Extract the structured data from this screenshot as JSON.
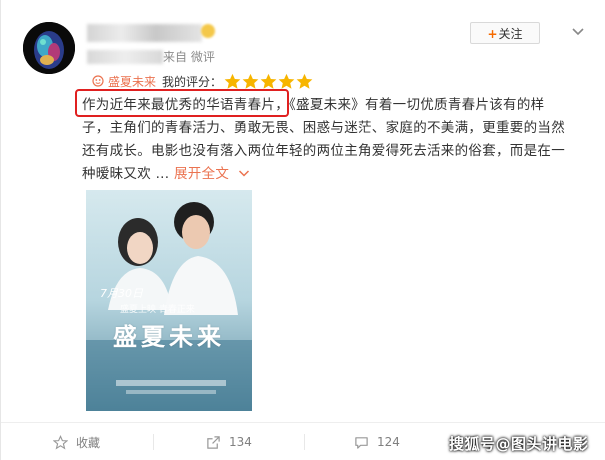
{
  "post": {
    "source_suffix": "来自 微评",
    "follow_label": "关注",
    "rating": {
      "movie": "盛夏未来",
      "label": "我的评分：",
      "stars": 5,
      "star_color": "#f7b500"
    },
    "content": {
      "line1_highlight": "作为近年来最优秀的华语青春片",
      "line1_rest": "，《盛夏未来》有着一切优质青春片该有的样",
      "line2": "子，主角们的青春活力、勇敢无畏、困惑与迷茫、家庭的不美满，更重要的当然",
      "line3": "还有成长。电影也没有落入两位年轻的两位主角爱得死去活来的俗套，而是在一",
      "line4": "种暧昧又欢 ...",
      "expand_label": "展开全文",
      "highlight_color": "#e02020",
      "link_color": "#eb7350"
    },
    "poster": {
      "title": "盛夏未来",
      "date": "7月30日",
      "subtitle": "盛夏上映 青春正来"
    }
  },
  "footer": {
    "favorite_label": "收藏",
    "repost_count": "134",
    "comment_count": "",
    "like_count": "124",
    "watermark": "搜狐号@图头讲电影"
  }
}
